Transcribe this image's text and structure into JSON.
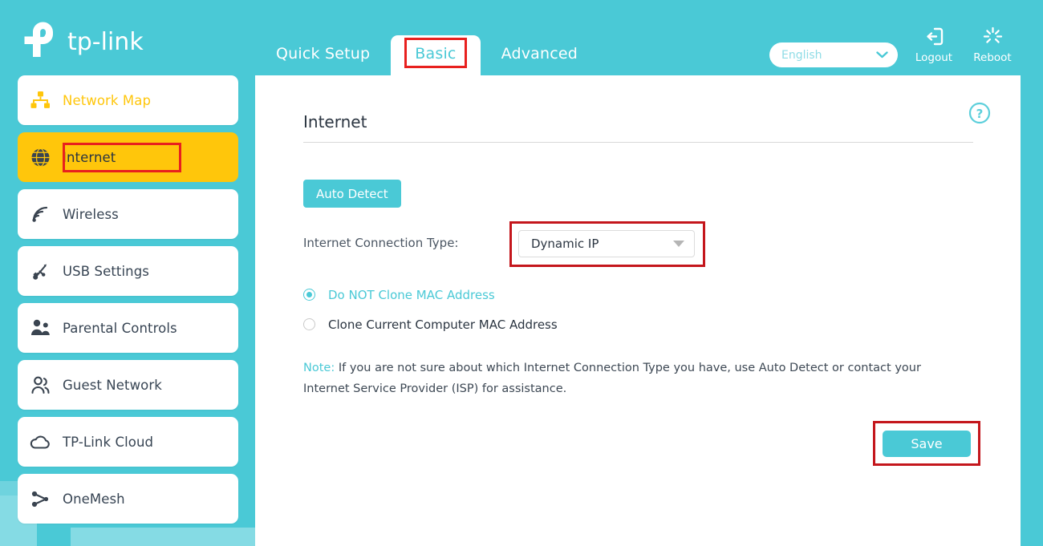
{
  "brand": {
    "name": "tp-link",
    "logo_icon": "tp-link-logo-icon",
    "accent_teal": "#4ac9d6",
    "accent_yellow": "#ffc60b",
    "annotation_red": "#c4161c"
  },
  "header": {
    "tabs": [
      {
        "label": "Quick Setup",
        "active": false,
        "annotated": false
      },
      {
        "label": "Basic",
        "active": true,
        "annotated": true
      },
      {
        "label": "Advanced",
        "active": false,
        "annotated": false
      }
    ],
    "language": {
      "value": "English",
      "chevron_icon": "chevron-down-icon"
    },
    "actions": [
      {
        "label": "Logout",
        "icon": "logout-icon"
      },
      {
        "label": "Reboot",
        "icon": "reboot-icon"
      }
    ]
  },
  "sidebar": {
    "items": [
      {
        "label": "Network Map",
        "icon": "sitemap-icon",
        "state": "hovered"
      },
      {
        "label": "Internet",
        "icon": "globe-icon",
        "state": "selected"
      },
      {
        "label": "Wireless",
        "icon": "wifi-signal-icon",
        "state": "normal"
      },
      {
        "label": "USB Settings",
        "icon": "usb-icon",
        "state": "normal"
      },
      {
        "label": "Parental Controls",
        "icon": "parent-child-icon",
        "state": "normal"
      },
      {
        "label": "Guest Network",
        "icon": "two-people-icon",
        "state": "normal"
      },
      {
        "label": "TP-Link Cloud",
        "icon": "cloud-icon",
        "state": "normal"
      },
      {
        "label": "OneMesh",
        "icon": "mesh-node-icon",
        "state": "normal"
      }
    ]
  },
  "main": {
    "title": "Internet",
    "help_icon": "question-circle-icon",
    "auto_detect_label": "Auto Detect",
    "connection_type": {
      "label": "Internet Connection Type:",
      "value": "Dynamic IP",
      "caret_icon": "triangle-down-icon",
      "annotated": true
    },
    "mac_clone": {
      "options": [
        {
          "label": "Do NOT Clone MAC Address",
          "checked": true
        },
        {
          "label": "Clone Current Computer MAC Address",
          "checked": false
        }
      ]
    },
    "note": {
      "keyword": "Note:",
      "text": "If you are not sure about which Internet Connection Type you have, use Auto Detect or contact your Internet Service Provider (ISP) for assistance."
    },
    "save_label": "Save",
    "save_annotated": true
  }
}
